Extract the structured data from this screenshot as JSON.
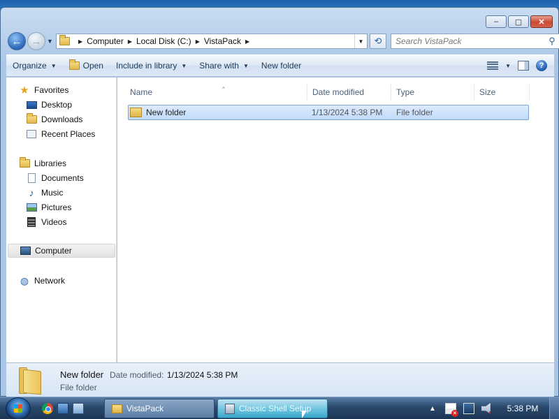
{
  "window": {
    "minimize_label": "–",
    "maximize_label": "▢",
    "close_label": "✕"
  },
  "address_bar": {
    "crumbs": [
      "Computer",
      "Local Disk (C:)",
      "VistaPack"
    ],
    "separator": "▶",
    "dropdown": "▼"
  },
  "search": {
    "placeholder": "Search VistaPack",
    "icon": "magnifier-icon"
  },
  "toolbar": {
    "organize": "Organize",
    "open": "Open",
    "include_in_library": "Include in library",
    "share_with": "Share with",
    "new_folder": "New folder",
    "help": "?"
  },
  "nav_pane": {
    "favorites_header": "Favorites",
    "favorites": [
      "Desktop",
      "Downloads",
      "Recent Places"
    ],
    "libraries_header": "Libraries",
    "libraries": [
      "Documents",
      "Music",
      "Pictures",
      "Videos"
    ],
    "computer": "Computer",
    "network": "Network"
  },
  "file_list": {
    "columns": [
      "Name",
      "Date modified",
      "Type",
      "Size"
    ],
    "sort_glyph": "^",
    "rows": [
      {
        "name": "New folder",
        "date_modified": "1/13/2024 5:38 PM",
        "type": "File folder",
        "size": ""
      }
    ]
  },
  "details_pane": {
    "name": "New folder",
    "date_modified_label": "Date modified:",
    "date_modified_value": "1/13/2024 5:38 PM",
    "type": "File folder"
  },
  "taskbar": {
    "buttons": [
      "VistaPack",
      "Classic Shell Setup"
    ],
    "active_button": "Classic Shell Setup",
    "clock": "5:38 PM",
    "tray_arrow": "▲"
  },
  "colors": {
    "selection_fill": "#cce4fc",
    "selection_border": "#7da2ce",
    "taskbar": "#29486c",
    "window_frame": "#bcd3ec"
  }
}
